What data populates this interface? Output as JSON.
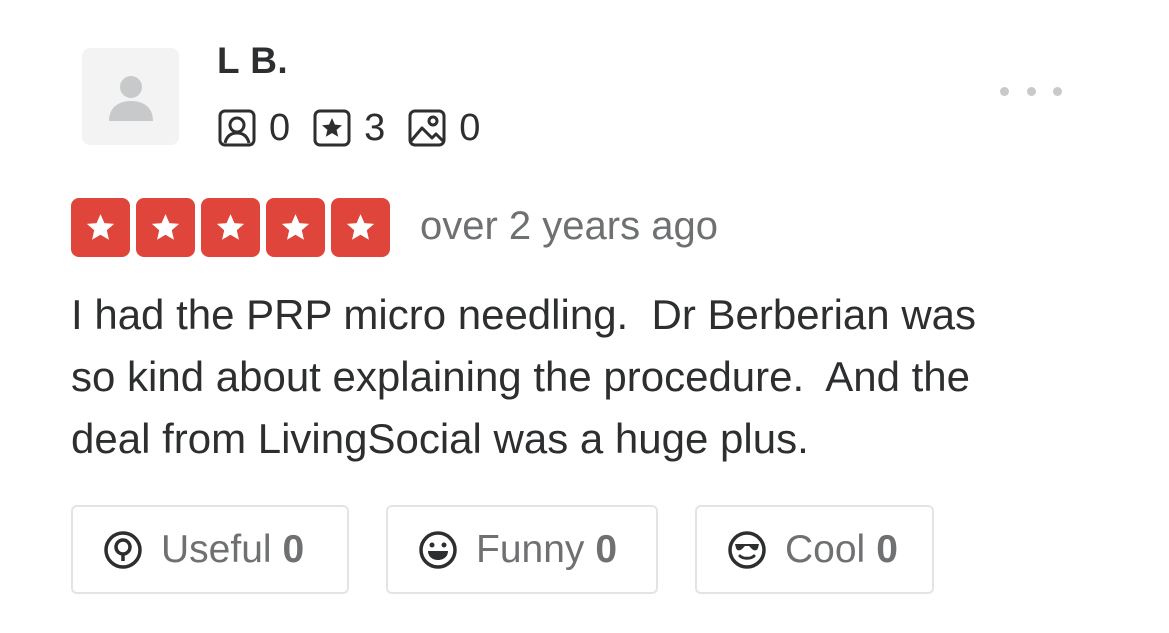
{
  "user": {
    "name": "L B.",
    "avatar_icon": "default-user-icon",
    "stats": [
      {
        "icon": "friends-icon",
        "count": "0"
      },
      {
        "icon": "reviews-star-icon",
        "count": "3"
      },
      {
        "icon": "photos-icon",
        "count": "0"
      }
    ]
  },
  "menu": {
    "icon": "more-options-icon"
  },
  "review": {
    "rating": 5,
    "rating_color": "#e0453b",
    "date": "over 2 years ago",
    "text": "I had the PRP micro needling.  Dr Berberian was\nso kind about explaining the procedure.  And the\ndeal from LivingSocial was a huge plus."
  },
  "reactions": [
    {
      "icon": "useful-bulb-icon",
      "label": "Useful",
      "count": "0"
    },
    {
      "icon": "funny-face-icon",
      "label": "Funny",
      "count": "0"
    },
    {
      "icon": "cool-sunglasses-icon",
      "label": "Cool",
      "count": "0"
    }
  ]
}
